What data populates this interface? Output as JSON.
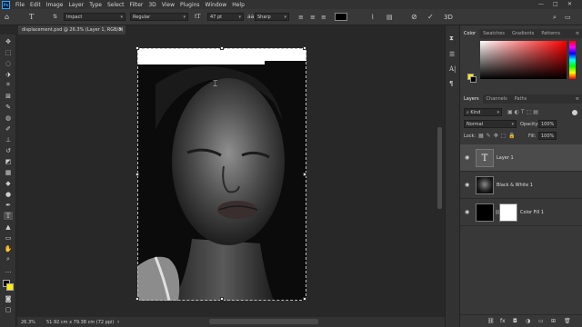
{
  "menu": [
    "File",
    "Edit",
    "Image",
    "Layer",
    "Type",
    "Select",
    "Filter",
    "3D",
    "View",
    "Plugins",
    "Window",
    "Help"
  ],
  "options": {
    "font_family": "Impact",
    "font_style": "Regular",
    "font_size": "47 pt",
    "antialias": "Sharp"
  },
  "document": {
    "tab_title": "displacement.psd @ 26.3% (Layer 1, RGB/8) *",
    "zoom": "26.3%",
    "dimensions": "51.92 cm x 79.38 cm (72 ppi)"
  },
  "color_panel": {
    "tabs": [
      "Color",
      "Swatches",
      "Gradients",
      "Patterns"
    ],
    "foreground": "#ffed00",
    "background": "#000000",
    "picker_hue": "#ff0000"
  },
  "layers_panel": {
    "tabs": [
      "Layers",
      "Channels",
      "Paths"
    ],
    "kind_label": "Kind",
    "blend_mode": "Normal",
    "opacity_label": "Opacity:",
    "opacity_value": "100%",
    "lock_label": "Lock:",
    "fill_label": "Fill:",
    "fill_value": "100%",
    "layers": [
      {
        "name": "Layer 1",
        "type": "text",
        "selected": true
      },
      {
        "name": "Black & White 1",
        "type": "adjustment",
        "selected": false
      },
      {
        "name": "Color Fill 1",
        "type": "fill",
        "selected": false
      }
    ]
  },
  "colors": {
    "accent": "#31a8ff",
    "foreground_swatch": "#ffed00"
  }
}
